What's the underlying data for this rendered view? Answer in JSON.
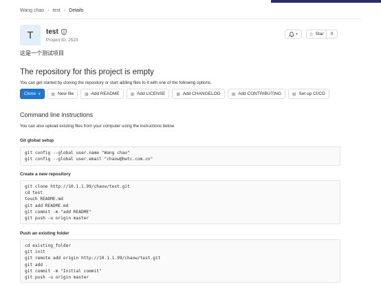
{
  "breadcrumb": {
    "items": [
      "Wang chao",
      "test",
      "Details"
    ]
  },
  "project": {
    "avatar_letter": "T",
    "name": "test",
    "id_text": "Project ID: 2523",
    "description": "这是一个测试项目"
  },
  "header_actions": {
    "notifications_icon": "bell-icon",
    "star_label": "Star",
    "star_count": "0"
  },
  "empty_repo": {
    "title": "The repository for this project is empty",
    "subtitle": "You can get started by cloning the repository or start adding files to it with one of the following options."
  },
  "actions": {
    "clone": "Clone",
    "new_file": "New file",
    "add_readme": "Add README",
    "add_license": "Add LICENSE",
    "add_changelog": "Add CHANGELOG",
    "add_contributing": "Add CONTRIBUTING",
    "setup_cicd": "Set up CI/CD"
  },
  "command_line": {
    "title": "Command line instructions",
    "subtitle": "You can also upload existing files from your computer using the instructions below."
  },
  "sections": {
    "git_global": {
      "title": "Git global setup",
      "code": "git config --global user.name \"Wang chao\"\ngit config --global user.email \"chaow@hwtc.com.cn\""
    },
    "new_repo": {
      "title": "Create a new repository",
      "code": "git clone http://10.1.1.99/chaow/test.git\ncd test\ntouch README.md\ngit add README.md\ngit commit -m \"add README\"\ngit push -u origin master"
    },
    "existing_folder": {
      "title": "Push an existing folder",
      "code": "cd existing_folder\ngit init\ngit remote add origin http://10.1.1.99/chaow/test.git\ngit add .\ngit commit -m \"Initial commit\"\ngit push -u origin master"
    }
  }
}
